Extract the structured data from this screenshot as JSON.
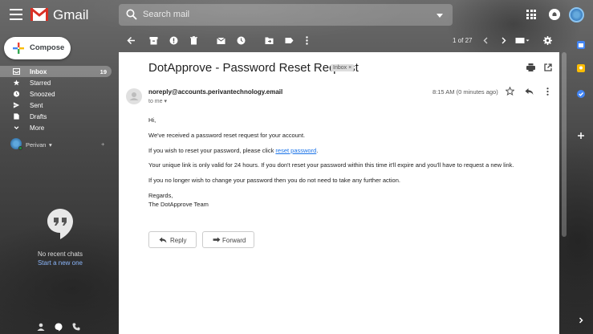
{
  "app": {
    "brand": "Gmail"
  },
  "search": {
    "placeholder": "Search mail"
  },
  "compose": {
    "label": "Compose"
  },
  "nav": {
    "items": [
      {
        "label": "Inbox",
        "count": "19",
        "icon": "inbox-icon",
        "active": true
      },
      {
        "label": "Starred",
        "icon": "star-icon"
      },
      {
        "label": "Snoozed",
        "icon": "clock-icon"
      },
      {
        "label": "Sent",
        "icon": "send-icon"
      },
      {
        "label": "Drafts",
        "icon": "draft-icon"
      },
      {
        "label": "More",
        "icon": "chevron-down-icon"
      }
    ]
  },
  "hangouts": {
    "user": "Perivan",
    "empty": "No recent chats",
    "start": "Start a new one"
  },
  "toolbar": {
    "pager": "1 of 27"
  },
  "mail": {
    "subject": "DotApprove - Password Reset Request",
    "label": "Inbox ×",
    "sender": "noreply@accounts.perivantechnology.email",
    "to": "to me",
    "time": "8:15 AM (0 minutes ago)",
    "greeting": "Hi,",
    "line1": "We've received a password reset request for your account.",
    "line2_pre": "If you wish to reset your password, please click ",
    "line2_link": "reset password",
    "line2_post": ".",
    "line3": "Your unique link is only valid for 24 hours. If you don't reset your password within this time it'll expire and you'll have to request a new link.",
    "line4": "If you no longer wish to change your password then you do not need to take any further action.",
    "sign1": "Regards,",
    "sign2": "The DotApprove Team",
    "reply": "Reply",
    "forward": "Forward"
  },
  "colors": {
    "link": "#1a73e8",
    "accent": "#d93025"
  }
}
